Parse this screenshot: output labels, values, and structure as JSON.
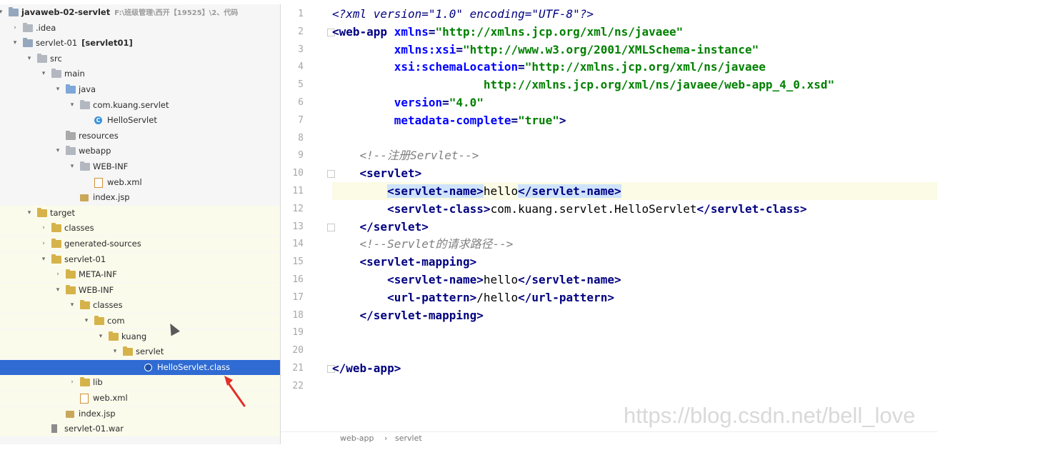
{
  "project_tree": {
    "items": [
      {
        "label": "javaweb-02-servlet",
        "extra": "F:\\班级管理\\西开【19525】\\2、代码",
        "arrow": "▾",
        "icon": "module-folder-icon",
        "bold": true
      },
      {
        "label": ".idea",
        "arrow": "›",
        "icon": "folder-icon"
      },
      {
        "label": "servlet-01",
        "extra": "[servlet01]",
        "arrow": "▾",
        "icon": "module-folder-icon"
      },
      {
        "label": "src",
        "arrow": "▾",
        "icon": "folder-icon"
      },
      {
        "label": "main",
        "arrow": "▾",
        "icon": "folder-icon"
      },
      {
        "label": "java",
        "arrow": "▾",
        "icon": "source-folder-icon"
      },
      {
        "label": "com.kuang.servlet",
        "arrow": "▾",
        "icon": "package-icon"
      },
      {
        "label": "HelloServlet",
        "arrow": "",
        "icon": "java-class-icon"
      },
      {
        "label": "resources",
        "arrow": "",
        "icon": "resources-folder-icon"
      },
      {
        "label": "webapp",
        "arrow": "▾",
        "icon": "folder-icon"
      },
      {
        "label": "WEB-INF",
        "arrow": "▾",
        "icon": "folder-icon"
      },
      {
        "label": "web.xml",
        "arrow": "",
        "icon": "xml-file-icon"
      },
      {
        "label": "index.jsp",
        "arrow": "",
        "icon": "jsp-file-icon"
      },
      {
        "label": "target",
        "arrow": "▾",
        "icon": "excluded-folder-icon"
      },
      {
        "label": "classes",
        "arrow": "›",
        "icon": "excluded-folder-icon"
      },
      {
        "label": "generated-sources",
        "arrow": "›",
        "icon": "excluded-folder-icon"
      },
      {
        "label": "servlet-01",
        "arrow": "▾",
        "icon": "excluded-folder-icon"
      },
      {
        "label": "META-INF",
        "arrow": "›",
        "icon": "excluded-folder-icon"
      },
      {
        "label": "WEB-INF",
        "arrow": "▾",
        "icon": "excluded-folder-icon"
      },
      {
        "label": "classes",
        "arrow": "▾",
        "icon": "excluded-folder-icon"
      },
      {
        "label": "com",
        "arrow": "▾",
        "icon": "excluded-folder-icon"
      },
      {
        "label": "kuang",
        "arrow": "▾",
        "icon": "excluded-folder-icon"
      },
      {
        "label": "servlet",
        "arrow": "▾",
        "icon": "excluded-folder-icon"
      },
      {
        "label": "HelloServlet.class",
        "arrow": "",
        "icon": "class-file-icon"
      },
      {
        "label": "lib",
        "arrow": "›",
        "icon": "excluded-folder-icon"
      },
      {
        "label": "web.xml",
        "arrow": "",
        "icon": "xml-file-icon"
      },
      {
        "label": "index.jsp",
        "arrow": "",
        "icon": "jsp-file-icon"
      },
      {
        "label": "servlet-01.war",
        "arrow": "",
        "icon": "war-file-icon"
      }
    ],
    "selected_item": "HelloServlet.class"
  },
  "editor": {
    "line_numbers": [
      "1",
      "2",
      "3",
      "4",
      "5",
      "6",
      "7",
      "8",
      "9",
      "10",
      "11",
      "12",
      "13",
      "14",
      "15",
      "16",
      "17",
      "18",
      "19",
      "20",
      "21",
      "22"
    ],
    "current_line": "11",
    "lines": [
      [
        [
          "pi",
          "<?xml version=\"1.0\" encoding=\"UTF-8\"?>"
        ]
      ],
      [
        [
          "tag",
          "<web-app "
        ],
        [
          "attr",
          "xmlns"
        ],
        [
          "tag",
          "="
        ],
        [
          "val",
          "\"http://xmlns.jcp.org/xml/ns/javaee\""
        ]
      ],
      [
        [
          "plain",
          "         "
        ],
        [
          "attr",
          "xmlns:xsi"
        ],
        [
          "tag",
          "="
        ],
        [
          "val",
          "\"http://www.w3.org/2001/XMLSchema-instance\""
        ]
      ],
      [
        [
          "plain",
          "         "
        ],
        [
          "attr",
          "xsi:schemaLocation"
        ],
        [
          "tag",
          "="
        ],
        [
          "val",
          "\"http://xmlns.jcp.org/xml/ns/javaee"
        ]
      ],
      [
        [
          "plain",
          "                      "
        ],
        [
          "val",
          "http://xmlns.jcp.org/xml/ns/javaee/web-app_4_0.xsd\""
        ]
      ],
      [
        [
          "plain",
          "         "
        ],
        [
          "attr",
          "version"
        ],
        [
          "tag",
          "="
        ],
        [
          "val",
          "\"4.0\""
        ]
      ],
      [
        [
          "plain",
          "         "
        ],
        [
          "attr",
          "metadata-complete"
        ],
        [
          "tag",
          "="
        ],
        [
          "val",
          "\"true\""
        ],
        [
          "tag",
          ">"
        ]
      ],
      [],
      [
        [
          "plain",
          "    "
        ],
        [
          "com",
          "<!--注册Servlet-->"
        ]
      ],
      [
        [
          "plain",
          "    "
        ],
        [
          "tag",
          "<servlet>"
        ]
      ],
      [
        [
          "plain",
          "        "
        ],
        [
          "tagh",
          "<servlet-name>"
        ],
        [
          "plain",
          "hello"
        ],
        [
          "tagh",
          "</servlet-name>"
        ]
      ],
      [
        [
          "plain",
          "        "
        ],
        [
          "tag",
          "<servlet-class>"
        ],
        [
          "plain",
          "com.kuang.servlet.HelloServlet"
        ],
        [
          "tag",
          "</servlet-class>"
        ]
      ],
      [
        [
          "plain",
          "    "
        ],
        [
          "tag",
          "</servlet>"
        ]
      ],
      [
        [
          "plain",
          "    "
        ],
        [
          "com",
          "<!--Servlet的请求路径-->"
        ]
      ],
      [
        [
          "plain",
          "    "
        ],
        [
          "tag",
          "<servlet-mapping>"
        ]
      ],
      [
        [
          "plain",
          "        "
        ],
        [
          "tag",
          "<servlet-name>"
        ],
        [
          "plain",
          "hello"
        ],
        [
          "tag",
          "</servlet-name>"
        ]
      ],
      [
        [
          "plain",
          "        "
        ],
        [
          "tag",
          "<url-pattern>"
        ],
        [
          "plain",
          "/hello"
        ],
        [
          "tag",
          "</url-pattern>"
        ]
      ],
      [
        [
          "plain",
          "    "
        ],
        [
          "tag",
          "</servlet-mapping>"
        ]
      ],
      [],
      [],
      [
        [
          "tag",
          "</web-app>"
        ]
      ],
      []
    ],
    "breadcrumb": [
      "web-app",
      "servlet"
    ],
    "breadcrumb_separator": "›"
  },
  "watermark": "https://blog.csdn.net/bell_love",
  "colors": {
    "selection": "#2f6bd2",
    "tag": "#000080",
    "attribute": "#0000ff",
    "string": "#008000",
    "comment": "#808080",
    "match_highlight": "#cfe4fb",
    "current_line": "#fbfbe6",
    "annotation_arrow": "#e0312a"
  }
}
